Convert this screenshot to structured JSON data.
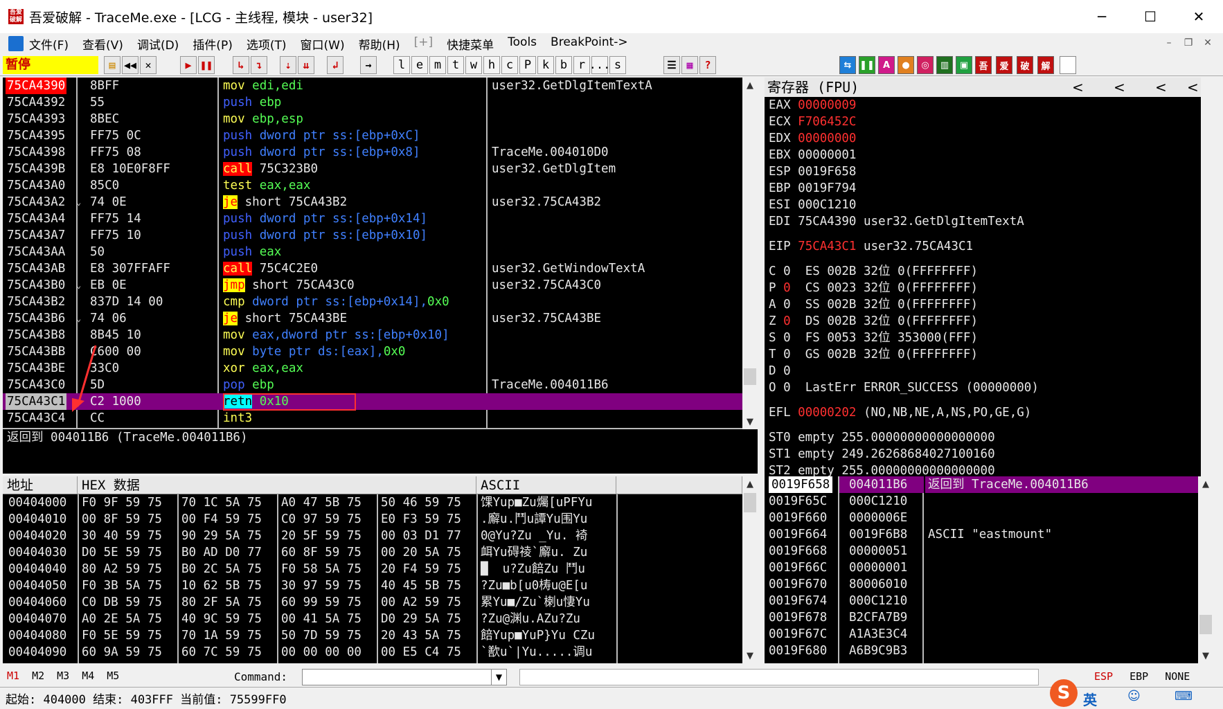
{
  "window": {
    "title": "吾爱破解 - TraceMe.exe - [LCG - 主线程, 模块 - user32]",
    "icon_text": "吾爱\n破解"
  },
  "menu": [
    "文件(F)",
    "查看(V)",
    "调试(D)",
    "插件(P)",
    "选项(T)",
    "窗口(W)",
    "帮助(H)",
    "[+]",
    "快捷菜单",
    "Tools",
    "BreakPoint->"
  ],
  "toolbar": {
    "status": "暂停",
    "letters": [
      "l",
      "e",
      "m",
      "t",
      "w",
      "h",
      "c",
      "P",
      "k",
      "b",
      "r",
      "...",
      "s"
    ],
    "plugins": [
      "吾",
      "爱",
      "破",
      "解"
    ]
  },
  "disasm": [
    {
      "addr": "75CA4390",
      "hex": "8BFF",
      "op": "mov",
      "args": [
        [
          "reg",
          "edi,edi"
        ]
      ],
      "comment": "user32.GetDlgItemTextA",
      "sel": true
    },
    {
      "addr": "75CA4392",
      "hex": "55",
      "op": "push",
      "args": [
        [
          "reg",
          "ebp"
        ]
      ],
      "comment": ""
    },
    {
      "addr": "75CA4393",
      "hex": "8BEC",
      "op": "mov",
      "args": [
        [
          "reg",
          "ebp,esp"
        ]
      ],
      "comment": ""
    },
    {
      "addr": "75CA4395",
      "hex": "FF75 0C",
      "op": "push",
      "args": [
        [
          "mem",
          "dword ptr ss:[ebp+0xC]"
        ]
      ],
      "comment": ""
    },
    {
      "addr": "75CA4398",
      "hex": "FF75 08",
      "op": "push",
      "args": [
        [
          "mem",
          "dword ptr ss:[ebp+0x8]"
        ]
      ],
      "comment": "TraceMe.004010D0"
    },
    {
      "addr": "75CA439B",
      "hex": "E8 10E0F8FF",
      "op": "call",
      "args": [
        [
          "txt",
          "75C323B0"
        ]
      ],
      "comment": "user32.GetDlgItem"
    },
    {
      "addr": "75CA43A0",
      "hex": "85C0",
      "op": "test",
      "args": [
        [
          "reg",
          "eax,eax"
        ]
      ],
      "comment": ""
    },
    {
      "addr": "75CA43A2",
      "hex": "74 0E",
      "op": "je",
      "args": [
        [
          "txt",
          "short 75CA43B2"
        ]
      ],
      "comment": "user32.75CA43B2",
      "jmp": true
    },
    {
      "addr": "75CA43A4",
      "hex": "FF75 14",
      "op": "push",
      "args": [
        [
          "mem",
          "dword ptr ss:[ebp+0x14]"
        ]
      ],
      "comment": ""
    },
    {
      "addr": "75CA43A7",
      "hex": "FF75 10",
      "op": "push",
      "args": [
        [
          "mem",
          "dword ptr ss:[ebp+0x10]"
        ]
      ],
      "comment": ""
    },
    {
      "addr": "75CA43AA",
      "hex": "50",
      "op": "push",
      "args": [
        [
          "reg",
          "eax"
        ]
      ],
      "comment": ""
    },
    {
      "addr": "75CA43AB",
      "hex": "E8 307FFAFF",
      "op": "call",
      "args": [
        [
          "txt",
          "75C4C2E0"
        ]
      ],
      "comment": "user32.GetWindowTextA"
    },
    {
      "addr": "75CA43B0",
      "hex": "EB 0E",
      "op": "jmp",
      "args": [
        [
          "txt",
          "short 75CA43C0"
        ]
      ],
      "comment": "user32.75CA43C0",
      "jmp": true
    },
    {
      "addr": "75CA43B2",
      "hex": "837D 14 00",
      "op": "cmp",
      "args": [
        [
          "mem",
          "dword ptr ss:[ebp+0x14],"
        ],
        [
          "imm",
          "0x0"
        ]
      ],
      "comment": ""
    },
    {
      "addr": "75CA43B6",
      "hex": "74 06",
      "op": "je",
      "args": [
        [
          "txt",
          "short 75CA43BE"
        ]
      ],
      "comment": "user32.75CA43BE",
      "jmp": true
    },
    {
      "addr": "75CA43B8",
      "hex": "8B45 10",
      "op": "mov",
      "args": [
        [
          "mem",
          "eax,dword ptr ss:[ebp+0x10]"
        ]
      ],
      "comment": ""
    },
    {
      "addr": "75CA43BB",
      "hex": "C600 00",
      "op": "mov",
      "args": [
        [
          "mem",
          "byte ptr ds:[eax],"
        ],
        [
          "imm",
          "0x0"
        ]
      ],
      "comment": ""
    },
    {
      "addr": "75CA43BE",
      "hex": "33C0",
      "op": "xor",
      "args": [
        [
          "reg",
          "eax,eax"
        ]
      ],
      "comment": ""
    },
    {
      "addr": "75CA43C0",
      "hex": "5D",
      "op": "pop",
      "args": [
        [
          "reg",
          "ebp"
        ]
      ],
      "comment": "TraceMe.004011B6"
    },
    {
      "addr": "75CA43C1",
      "hex": "C2 1000",
      "op": "retn",
      "args": [
        [
          "imm",
          "0x10"
        ]
      ],
      "comment": "",
      "cur": true
    },
    {
      "addr": "75CA43C4",
      "hex": "CC",
      "op": "int3",
      "args": [],
      "comment": ""
    }
  ],
  "info_line": "返回到 004011B6 (TraceMe.004011B6)",
  "registers": {
    "title": "寄存器 (FPU)",
    "gp": [
      {
        "n": "EAX",
        "v": "00000009",
        "red": true,
        "c": ""
      },
      {
        "n": "ECX",
        "v": "F706452C",
        "red": true,
        "c": ""
      },
      {
        "n": "EDX",
        "v": "00000000",
        "red": true,
        "c": ""
      },
      {
        "n": "EBX",
        "v": "00000001",
        "c": ""
      },
      {
        "n": "ESP",
        "v": "0019F658",
        "c": ""
      },
      {
        "n": "EBP",
        "v": "0019F794",
        "c": ""
      },
      {
        "n": "ESI",
        "v": "000C1210",
        "c": ""
      },
      {
        "n": "EDI",
        "v": "75CA4390",
        "c": "user32.GetDlgItemTextA"
      }
    ],
    "eip": {
      "n": "EIP",
      "v": "75CA43C1",
      "c": "user32.75CA43C1"
    },
    "flags": [
      {
        "f": "C",
        "v": "0",
        "seg": "ES 002B 32位 0(FFFFFFFF)"
      },
      {
        "f": "P",
        "v": "0",
        "red": true,
        "seg": "CS 0023 32位 0(FFFFFFFF)"
      },
      {
        "f": "A",
        "v": "0",
        "seg": "SS 002B 32位 0(FFFFFFFF)"
      },
      {
        "f": "Z",
        "v": "0",
        "red": true,
        "seg": "DS 002B 32位 0(FFFFFFFF)"
      },
      {
        "f": "S",
        "v": "0",
        "seg": "FS 0053 32位 353000(FFF)"
      },
      {
        "f": "T",
        "v": "0",
        "seg": "GS 002B 32位 0(FFFFFFFF)"
      },
      {
        "f": "D",
        "v": "0",
        "seg": ""
      },
      {
        "f": "O",
        "v": "0",
        "seg": "LastErr ERROR_SUCCESS (00000000)"
      }
    ],
    "efl": {
      "n": "EFL",
      "v": "00000202",
      "c": "(NO,NB,NE,A,NS,PO,GE,G)"
    },
    "fpu": [
      "ST0 empty 255.00000000000000000",
      "ST1 empty 249.26268684027100160",
      "ST2 empty 255.00000000000000000"
    ]
  },
  "dump": {
    "h_addr": "地址",
    "h_hex": "HEX 数据",
    "h_ascii": "ASCII",
    "rows": [
      {
        "a": "00404000",
        "h": [
          "F0 9F 59 75",
          "70 1C 5A 75",
          "A0 47 5B 75",
          "50 46 59 75"
        ],
        "s": "馃Yup■Zu爥[uPFYu"
      },
      {
        "a": "00404010",
        "h": [
          "00 8F 59 75",
          "00 F4 59 75",
          "C0 97 59 75",
          "E0 F3 59 75"
        ],
        "s": ".廨u.鬥u譚Yu围Yu"
      },
      {
        "a": "00404020",
        "h": [
          "30 40 59 75",
          "90 29 5A 75",
          "20 5F 59 75",
          "00 03 D1 77"
        ],
        "s": "0@Yu?Zu _Yu. 裿"
      },
      {
        "a": "00404030",
        "h": [
          "D0 5E 59 75",
          "B0 AD D0 77",
          "60 8F 59 75",
          "00 20 5A 75"
        ],
        "s": "衈Yu碍祾`廨u. Zu"
      },
      {
        "a": "00404040",
        "h": [
          "80 A2 59 75",
          "B0 2C 5A 75",
          "F0 58 5A 75",
          "20 F4 59 75"
        ],
        "s": "█  u?Zu餢Zu 鬥u"
      },
      {
        "a": "00404050",
        "h": [
          "F0 3B 5A 75",
          "10 62 5B 75",
          "30 97 59 75",
          "40 45 5B 75"
        ],
        "s": "?Zu■b[u0梼u@E[u"
      },
      {
        "a": "00404060",
        "h": [
          "C0 DB 59 75",
          "80 2F 5A 75",
          "60 99 59 75",
          "00 A2 59 75"
        ],
        "s": "累Yu■/Zu`楋u悽Yu"
      },
      {
        "a": "00404070",
        "h": [
          "A0 2E 5A 75",
          "40 9C 59 75",
          "00 41 5A 75",
          "D0 29 5A 75"
        ],
        "s": "?Zu@渊u.AZu?Zu"
      },
      {
        "a": "00404080",
        "h": [
          "F0 5E 59 75",
          "70 1A 59 75",
          "50 7D 59 75",
          "20 43 5A 75"
        ],
        "s": "餢Yup■YuP}Yu CZu"
      },
      {
        "a": "00404090",
        "h": [
          "60 9A 59 75",
          "60 7C 59 75",
          "00 00 00 00",
          "00 E5 C4 75"
        ],
        "s": "`歚u`|Yu.....调u"
      }
    ]
  },
  "stack": [
    {
      "a": "0019F658",
      "v": "004011B6",
      "c": "返回到 TraceMe.004011B6",
      "sel": true
    },
    {
      "a": "0019F65C",
      "v": "000C1210",
      "c": ""
    },
    {
      "a": "0019F660",
      "v": "0000006E",
      "c": ""
    },
    {
      "a": "0019F664",
      "v": "0019F6B8",
      "c": "ASCII \"eastmount\""
    },
    {
      "a": "0019F668",
      "v": "00000051",
      "c": ""
    },
    {
      "a": "0019F66C",
      "v": "00000001",
      "c": ""
    },
    {
      "a": "0019F670",
      "v": "80006010",
      "c": ""
    },
    {
      "a": "0019F674",
      "v": "000C1210",
      "c": ""
    },
    {
      "a": "0019F678",
      "v": "B2CFA7B9",
      "c": ""
    },
    {
      "a": "0019F67C",
      "v": "A1A3E3C4",
      "c": ""
    },
    {
      "a": "0019F680",
      "v": "A6B9C9B3",
      "c": ""
    }
  ],
  "command": {
    "marks": [
      "M1",
      "M2",
      "M3",
      "M4",
      "M5"
    ],
    "label": "Command:",
    "value": "",
    "right": [
      "ESP",
      "EBP",
      "NONE"
    ]
  },
  "status": "起始: 404000 结束: 403FFF 当前值: 75599FF0"
}
